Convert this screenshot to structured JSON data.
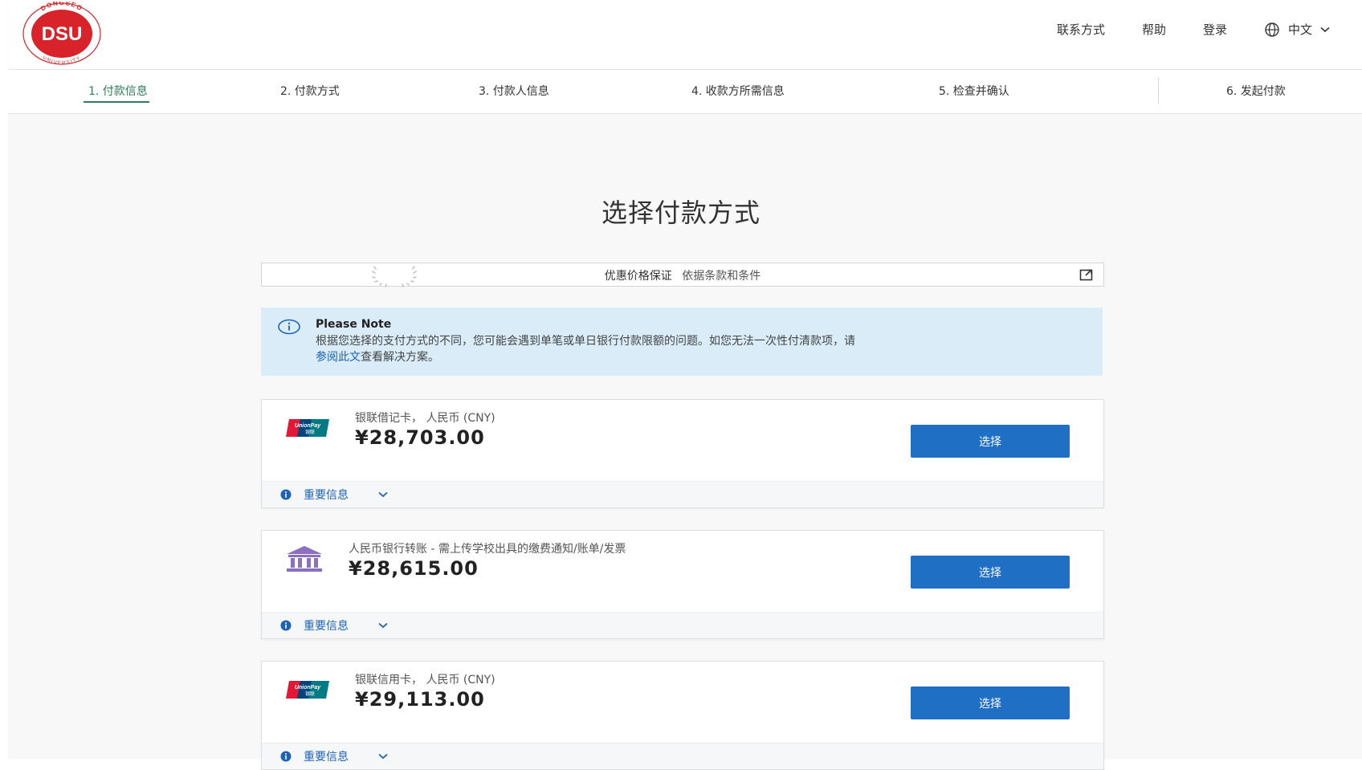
{
  "brand": {
    "ring_text": "DONGSEO",
    "name": "DSU",
    "ring_bottom": "UNIVERSITY",
    "color": "#d8232a"
  },
  "topnav": {
    "contact": "联系方式",
    "help": "帮助",
    "login": "登录",
    "language": "中文"
  },
  "steps": [
    {
      "label": "1. 付款信息",
      "active": true
    },
    {
      "label": "2. 付款方式",
      "active": false
    },
    {
      "label": "3. 付款人信息",
      "active": false
    },
    {
      "label": "4. 收款方所需信息",
      "active": false
    },
    {
      "label": "5. 检查并确认",
      "active": false
    },
    {
      "label": "6. 发起付款",
      "active": false
    }
  ],
  "page_title": "选择付款方式",
  "guarantee": {
    "text": "优惠价格保证",
    "link": "依据条款和条件"
  },
  "note": {
    "title": "Please Note",
    "body_text": "根据您选择的支付方式的不同，您可能会遇到单笔或单日银行付款限额的问题。如您无法一次性付清款项，请",
    "link_text": "参阅此文",
    "body_tail": "查看解决方案。"
  },
  "options": [
    {
      "icon": "unionpay-icon",
      "label": "银联借记卡， 人民币 (CNY)",
      "amount": "¥28,703.00",
      "button": "选择",
      "info": "重要信息"
    },
    {
      "icon": "bank-icon",
      "label": "人民币银行转账 - 需上传学校出具的缴费通知/账单/发票",
      "amount": "¥28,615.00",
      "button": "选择",
      "info": "重要信息"
    },
    {
      "icon": "unionpay-icon",
      "label": "银联信用卡， 人民币 (CNY)",
      "amount": "¥29,113.00",
      "button": "选择",
      "info": "重要信息"
    }
  ],
  "unionpay_text": "UnionPay",
  "unionpay_cn": "银联",
  "colors": {
    "accent_green": "#2f7d5b",
    "button_blue": "#1f6fc4",
    "note_bg": "#d9ecf8",
    "link_blue": "#1c62b8"
  }
}
